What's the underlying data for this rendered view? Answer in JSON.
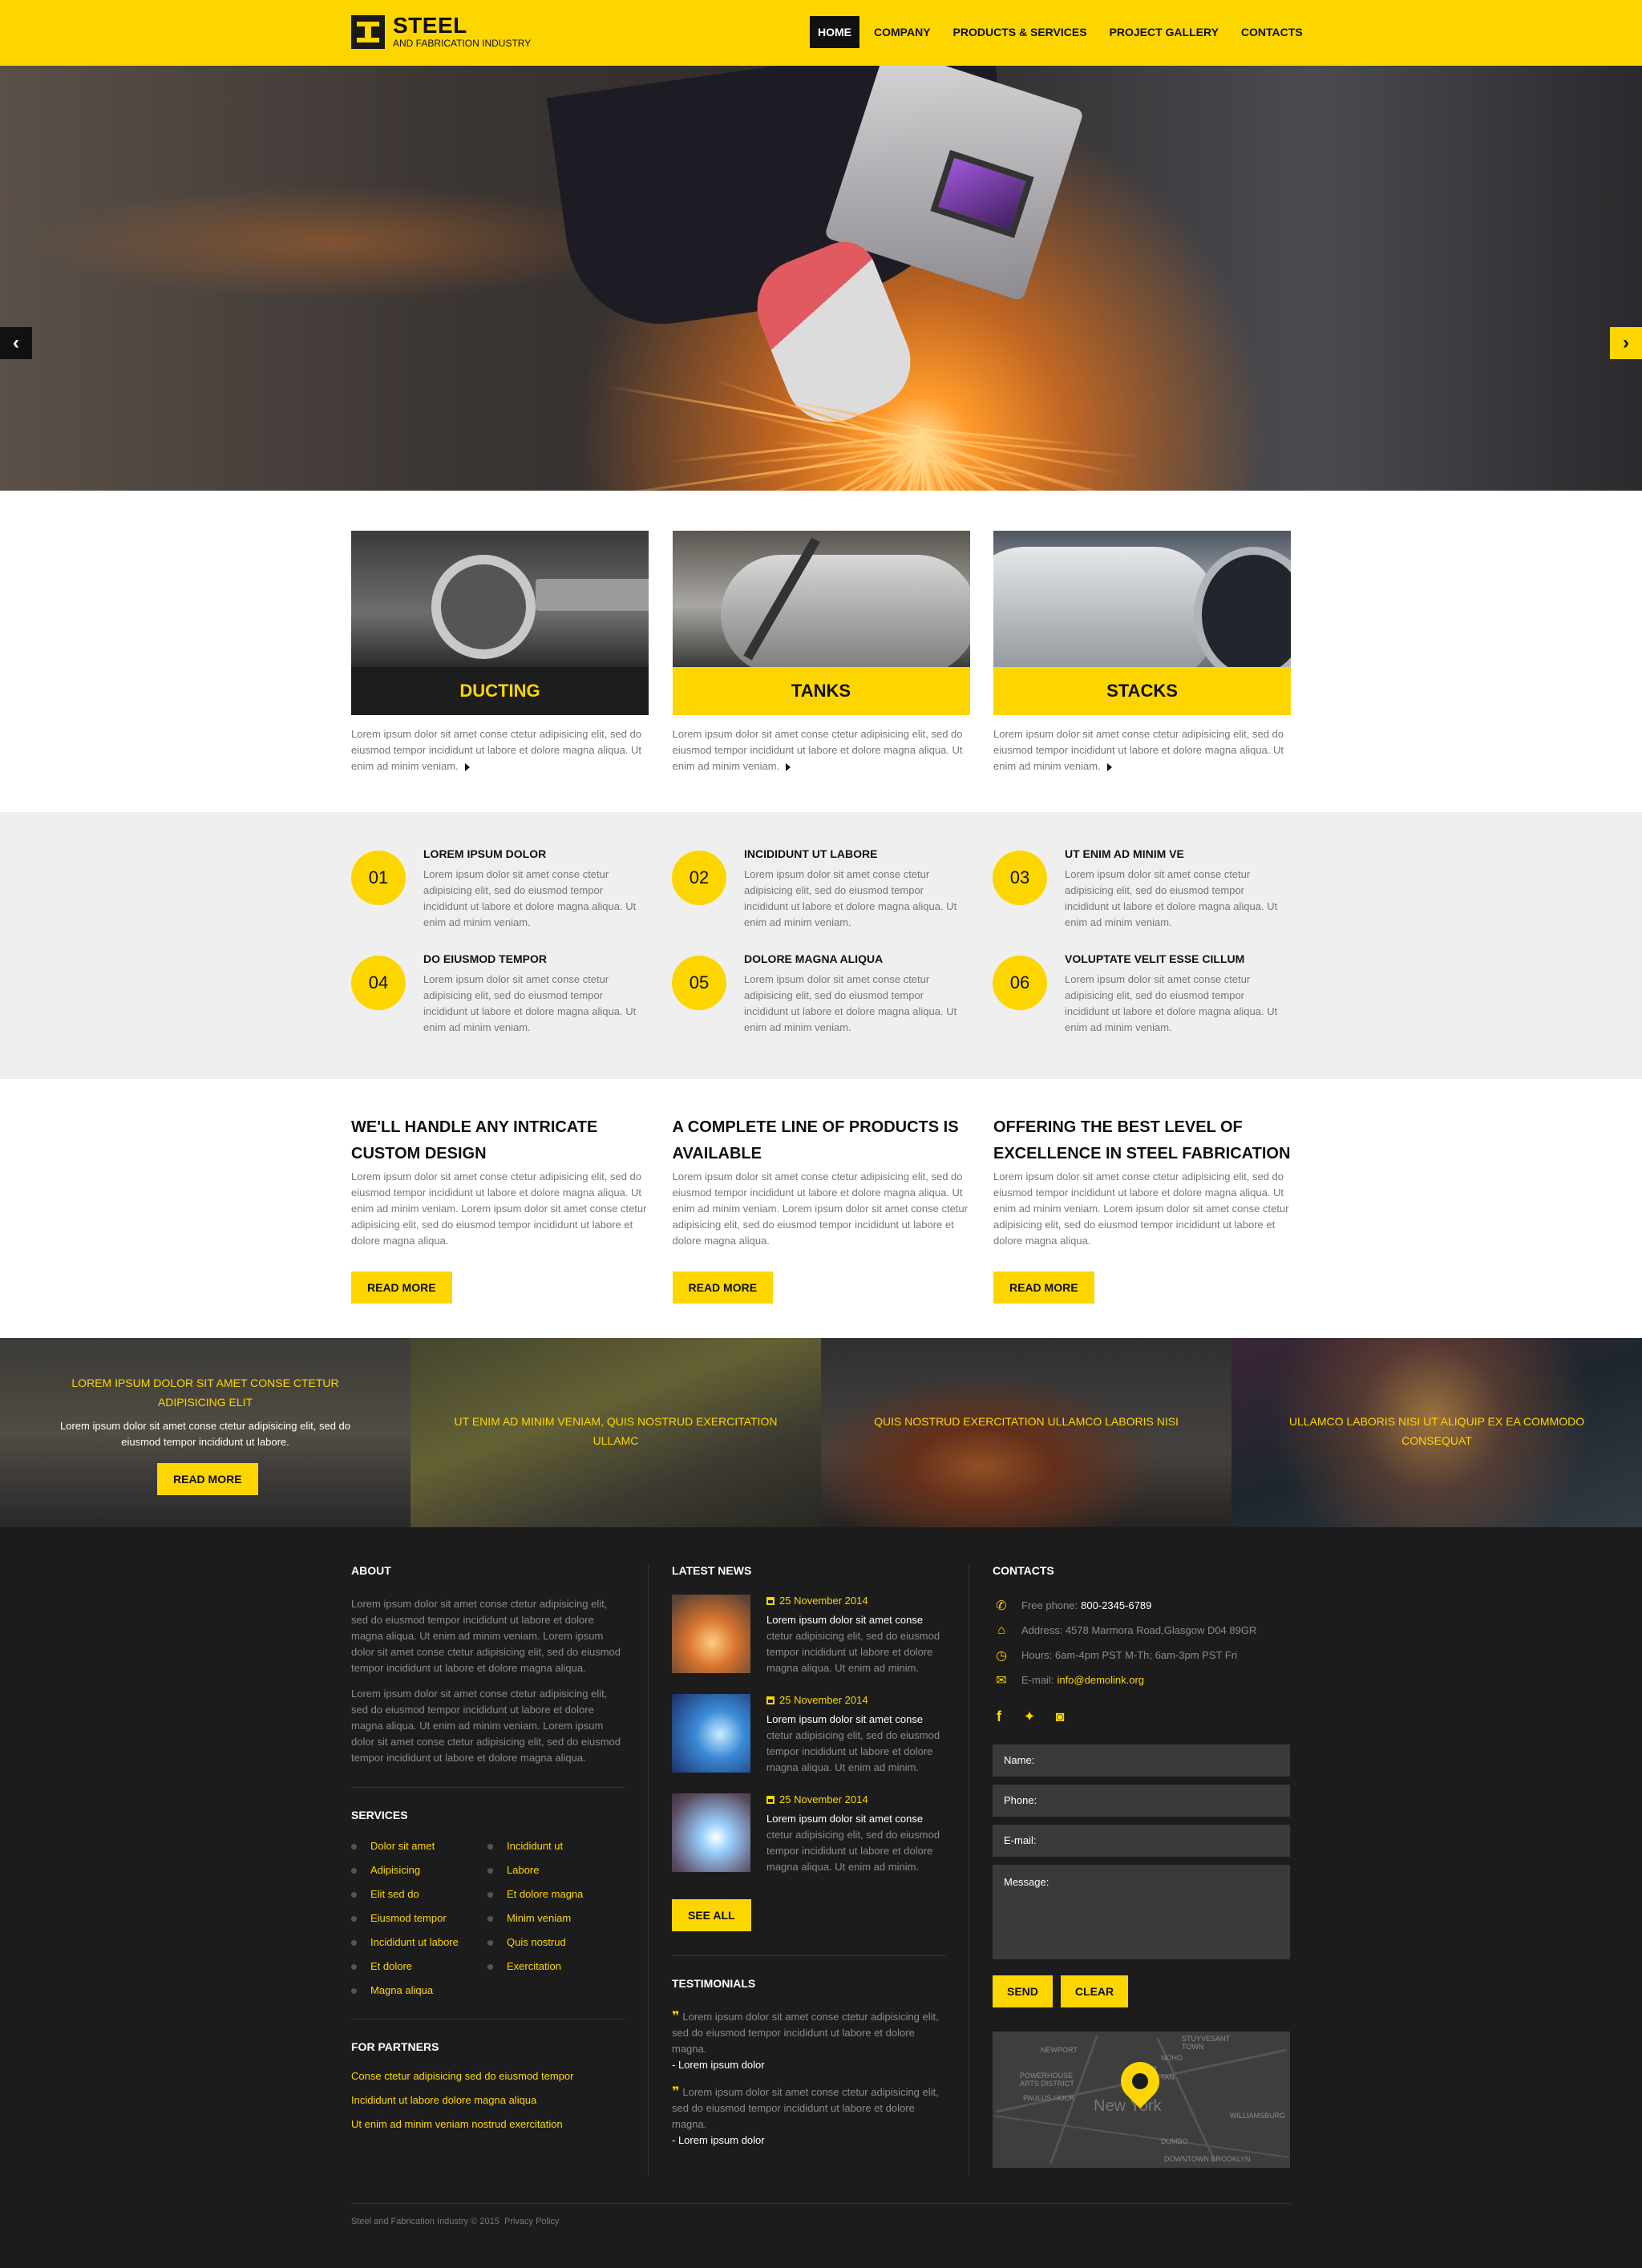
{
  "brand": {
    "name": "STEEL",
    "tagline": "AND FABRICATION INDUSTRY"
  },
  "nav": [
    {
      "label": "HOME",
      "active": true
    },
    {
      "label": "COMPANY",
      "active": false
    },
    {
      "label": "PRODUCTS & SERVICES",
      "active": false
    },
    {
      "label": "PROJECT GALLERY",
      "active": false
    },
    {
      "label": "CONTACTS",
      "active": false
    }
  ],
  "hero": {
    "prev_glyph": "‹",
    "next_glyph": "›"
  },
  "products": [
    {
      "title": "DUCTING",
      "style": "dark",
      "text": "Lorem ipsum dolor sit amet conse ctetur adipisicing elit, sed do eiusmod tempor incididunt ut labore et dolore magna aliqua. Ut enim ad minim veniam."
    },
    {
      "title": "TANKS",
      "style": "yellow",
      "text": "Lorem ipsum dolor sit amet conse ctetur adipisicing elit, sed do eiusmod tempor incididunt ut labore et dolore magna aliqua. Ut enim ad minim veniam."
    },
    {
      "title": "STACKS",
      "style": "yellow",
      "text": "Lorem ipsum dolor sit amet conse ctetur adipisicing elit, sed do eiusmod tempor incididunt ut labore et dolore magna aliqua. Ut enim ad minim veniam."
    }
  ],
  "features": [
    {
      "num": "01",
      "title": "LOREM IPSUM DOLOR",
      "text": "Lorem ipsum dolor sit amet conse ctetur adipisicing elit, sed do eiusmod tempor incididunt ut labore et dolore magna aliqua. Ut enim ad minim veniam."
    },
    {
      "num": "02",
      "title": "INCIDIDUNT UT LABORE",
      "text": "Lorem ipsum dolor sit amet conse ctetur adipisicing elit, sed do eiusmod tempor incididunt ut labore et dolore magna aliqua. Ut enim ad minim veniam."
    },
    {
      "num": "03",
      "title": "UT ENIM AD MINIM VE",
      "text": "Lorem ipsum dolor sit amet conse ctetur adipisicing elit, sed do eiusmod tempor incididunt ut labore et dolore magna aliqua. Ut enim ad minim veniam."
    },
    {
      "num": "04",
      "title": "DO EIUSMOD TEMPOR",
      "text": "Lorem ipsum dolor sit amet conse ctetur adipisicing elit, sed do eiusmod tempor incididunt ut labore et dolore magna aliqua. Ut enim ad minim veniam."
    },
    {
      "num": "05",
      "title": "DOLORE MAGNA ALIQUA",
      "text": "Lorem ipsum dolor sit amet conse ctetur adipisicing elit, sed do eiusmod tempor incididunt ut labore et dolore magna aliqua. Ut enim ad minim veniam."
    },
    {
      "num": "06",
      "title": "VOLUPTATE VELIT ESSE CILLUM",
      "text": "Lorem ipsum dolor sit amet conse ctetur adipisicing elit, sed do eiusmod tempor incididunt ut labore et dolore magna aliqua. Ut enim ad minim veniam."
    }
  ],
  "about": [
    {
      "title": "WE'LL HANDLE ANY INTRICATE CUSTOM DESIGN",
      "text": "Lorem ipsum dolor sit amet conse ctetur adipisicing elit, sed do eiusmod tempor incididunt ut labore et dolore magna aliqua. Ut enim ad minim veniam. Lorem ipsum dolor sit amet conse ctetur adipisicing elit, sed do eiusmod tempor incididunt ut labore et dolore magna aliqua.",
      "button": "READ MORE"
    },
    {
      "title": "A COMPLETE LINE OF PRODUCTS IS AVAILABLE",
      "text": "Lorem ipsum dolor sit amet conse ctetur adipisicing elit, sed do eiusmod tempor incididunt ut labore et dolore magna aliqua. Ut enim ad minim veniam. Lorem ipsum dolor sit amet conse ctetur adipisicing elit, sed do eiusmod tempor incididunt ut labore et dolore magna aliqua.",
      "button": "READ MORE"
    },
    {
      "title": "OFFERING THE BEST LEVEL OF EXCELLENCE IN STEEL FABRICATION",
      "text": "Lorem ipsum dolor sit amet conse ctetur adipisicing elit, sed do eiusmod tempor incididunt ut labore et dolore magna aliqua. Ut enim ad minim veniam. Lorem ipsum dolor sit amet conse ctetur adipisicing elit, sed do eiusmod tempor incididunt ut labore et dolore magna aliqua.",
      "button": "READ MORE"
    }
  ],
  "strip": [
    {
      "caption": "LOREM IPSUM DOLOR SIT AMET CONSE CTETUR ADIPISICING ELIT",
      "sub": "Lorem ipsum dolor sit amet conse ctetur adipisicing elit, sed do eiusmod tempor incididunt ut labore.",
      "button": "READ MORE"
    },
    {
      "caption": "UT ENIM AD MINIM VENIAM, QUIS NOSTRUD EXERCITATION ULLAMC"
    },
    {
      "caption": "QUIS NOSTRUD EXERCITATION ULLAMCO LABORIS NISI"
    },
    {
      "caption": "ULLAMCO LABORIS NISI UT ALIQUIP EX EA COMMODO CONSEQUAT"
    }
  ],
  "footer": {
    "about": {
      "title": "ABOUT",
      "p1": "Lorem ipsum dolor sit amet conse ctetur adipisicing elit, sed do eiusmod tempor incididunt ut labore et dolore magna aliqua. Ut enim ad minim veniam. Lorem ipsum dolor sit amet conse ctetur adipisicing elit, sed do eiusmod tempor incididunt ut labore et dolore magna aliqua.",
      "p2": "Lorem ipsum dolor sit amet conse ctetur adipisicing elit, sed do eiusmod tempor incididunt ut labore et dolore magna aliqua. Ut enim ad minim veniam. Lorem ipsum dolor sit amet conse ctetur adipisicing elit, sed do eiusmod tempor incididunt ut labore et dolore magna aliqua."
    },
    "services": {
      "title": "SERVICES",
      "col1": [
        "Dolor sit amet",
        "Adipisicing",
        "Elit sed do",
        "Eiusmod tempor",
        "Incididunt ut labore",
        "Et dolore",
        "Magna aliqua"
      ],
      "col2": [
        "Incididunt ut",
        "Labore",
        "Et dolore magna",
        "Minim veniam",
        "Quis nostrud",
        "Exercitation"
      ]
    },
    "partners": {
      "title": "FOR PARTNERS",
      "links": [
        "Conse ctetur adipisicing sed do eiusmod tempor",
        "Incididunt ut labore dolore magna aliqua",
        "Ut enim ad minim veniam nostrud exercitation"
      ]
    },
    "news": {
      "title": "LATEST NEWS",
      "items": [
        {
          "date": "25 November 2014",
          "head": "Lorem ipsum dolor sit amet conse",
          "body": "ctetur adipisicing elit, sed do eiusmod tempor incididunt ut labore et dolore magna aliqua. Ut enim ad minim."
        },
        {
          "date": "25 November 2014",
          "head": "Lorem ipsum dolor sit amet conse",
          "body": "ctetur adipisicing elit, sed do eiusmod tempor incididunt ut labore et dolore magna aliqua. Ut enim ad minim."
        },
        {
          "date": "25 November 2014",
          "head": "Lorem ipsum dolor sit amet conse",
          "body": "ctetur adipisicing elit, sed do eiusmod tempor incididunt ut labore et dolore magna aliqua. Ut enim ad minim."
        }
      ],
      "see_all": "SEE ALL"
    },
    "testimonials": {
      "title": "TESTIMONIALS",
      "items": [
        {
          "text": "Lorem ipsum dolor sit amet conse ctetur adipisicing elit, sed do eiusmod tempor incididunt ut labore et dolore magna.",
          "author": "- Lorem ipsum dolor"
        },
        {
          "text": "Lorem ipsum dolor sit amet conse ctetur adipisicing elit, sed do eiusmod tempor incididunt ut labore et dolore magna.",
          "author": "- Lorem ipsum dolor"
        }
      ]
    },
    "contacts": {
      "title": "CONTACTS",
      "phone_label": "Free phone:",
      "phone": "800-2345-6789",
      "address": "Address: 4578 Marmora Road,Glasgow D04 89GR",
      "hours": "Hours: 6am-4pm PST M-Th;  6am-3pm PST Fri",
      "email_label": "E-mail:",
      "email": "info@demolink.org",
      "social": {
        "facebook": "f",
        "twitter": "t",
        "instagram": "ig"
      },
      "form": {
        "name": "Name:",
        "phone": "Phone:",
        "email": "E-mail:",
        "message": "Message:",
        "send": "SEND",
        "clear": "CLEAR"
      },
      "map": {
        "city": "New York",
        "labels": [
          "NEWPORT",
          "STUYVESANT TOWN",
          "NOHO",
          "LOWER MANHATTAN",
          "POWERHOUSE ARTS DISTRICT",
          "PAULUS HOOK",
          "WILLIAMSBURG",
          "DUMBO",
          "DOWNTOWN BROOKLYN"
        ]
      }
    },
    "copyright": "Steel and Fabrication Industry © 2015",
    "privacy": "Privacy Policy"
  },
  "colors": {
    "accent": "#fdd600",
    "dark": "#1c1c1c",
    "light_bg": "#efefef"
  }
}
